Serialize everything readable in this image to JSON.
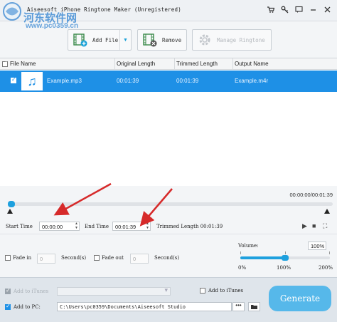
{
  "window": {
    "title": "Aiseesoft iPhone Ringtone Maker (Unregistered)",
    "watermark_text": "河东软件网",
    "watermark_url": "www.pc0359.cn",
    "icons": [
      "cart-icon",
      "key-icon",
      "feedback-icon",
      "minimize-icon",
      "close-icon"
    ]
  },
  "toolbar": {
    "add_file": "Add File",
    "remove": "Remove",
    "manage_ringtone": "Manage Ringtone"
  },
  "table": {
    "headers": [
      "File Name",
      "Original Length",
      "Trimmed Length",
      "Output Name"
    ],
    "rows": [
      {
        "checked": true,
        "file_name": "Example.mp3",
        "original_length": "00:01:39",
        "trimmed_length": "00:01:39",
        "output_name": "Example.m4r"
      }
    ]
  },
  "timeline": {
    "time_readout": "00:00:00/00:01:39",
    "position": 0,
    "start_label": "Start Time",
    "start_value": "00:00:00",
    "end_label": "End Time",
    "end_value": "00:01:39",
    "trimmed_length_label": "Trimmed Length 00:01:39"
  },
  "fade": {
    "fade_in_label": "Fade in",
    "fade_in_value": "0",
    "fade_in_unit": "Second(s)",
    "fade_out_label": "Fade out",
    "fade_out_value": "0",
    "fade_out_unit": "Second(s)"
  },
  "volume": {
    "label": "Volume:",
    "value": "100%",
    "value_fraction": 0.5,
    "min_label": "0%",
    "mid_label": "100%",
    "max_label": "200%"
  },
  "output": {
    "add_to_itunes_top": "Add to iTunes",
    "add_to_itunes": "Add to iTunes",
    "add_to_pc": "Add to PC:",
    "path": "C:\\Users\\pc0359\\Documents\\Aiseesoft Studio",
    "browse": "•••",
    "generate": "Generate"
  },
  "colors": {
    "accent": "#1e90e6",
    "generate": "#56b8ea",
    "annotation_arrow": "#d62a2a"
  }
}
